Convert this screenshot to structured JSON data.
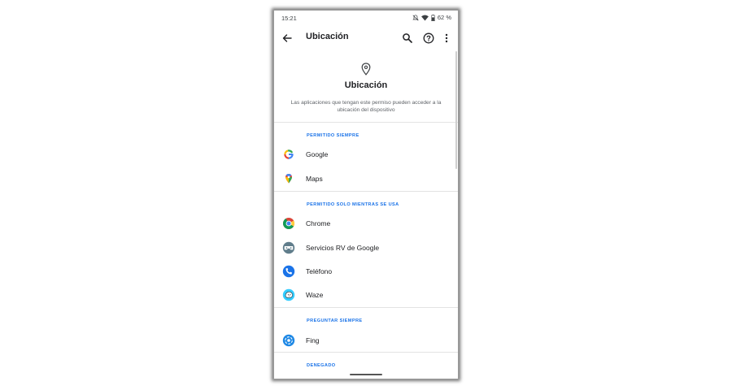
{
  "status_bar": {
    "time": "15:21",
    "battery": "62 %",
    "icons": [
      "notifications-off-icon",
      "wifi-icon",
      "battery-icon"
    ]
  },
  "app_bar": {
    "title": "Ubicación",
    "actions": [
      "back-arrow-icon",
      "search-icon",
      "help-icon",
      "more-vert-icon"
    ]
  },
  "header": {
    "icon": "location-pin-icon",
    "title": "Ubicación",
    "description": "Las aplicaciones que tengan este permiso pueden acceder a la ubicación del dispositivo"
  },
  "sections": [
    {
      "header": "PERMITIDO SIEMPRE",
      "apps": [
        {
          "name": "Google",
          "icon": "google-icon"
        },
        {
          "name": "Maps",
          "icon": "maps-icon"
        }
      ]
    },
    {
      "header": "PERMITIDO SOLO MIENTRAS SE USA",
      "apps": [
        {
          "name": "Chrome",
          "icon": "chrome-icon"
        },
        {
          "name": "Servicios RV de Google",
          "icon": "vr-services-icon"
        },
        {
          "name": "Teléfono",
          "icon": "phone-icon"
        },
        {
          "name": "Waze",
          "icon": "waze-icon"
        }
      ]
    },
    {
      "header": "PREGUNTAR SIEMPRE",
      "apps": [
        {
          "name": "Fing",
          "icon": "fing-icon"
        }
      ]
    },
    {
      "header": "DENEGADO",
      "apps": []
    }
  ],
  "colors": {
    "accent": "#1a73e8",
    "text_primary": "#202124",
    "text_secondary": "#5f6368",
    "divider": "#e3e3e3"
  }
}
